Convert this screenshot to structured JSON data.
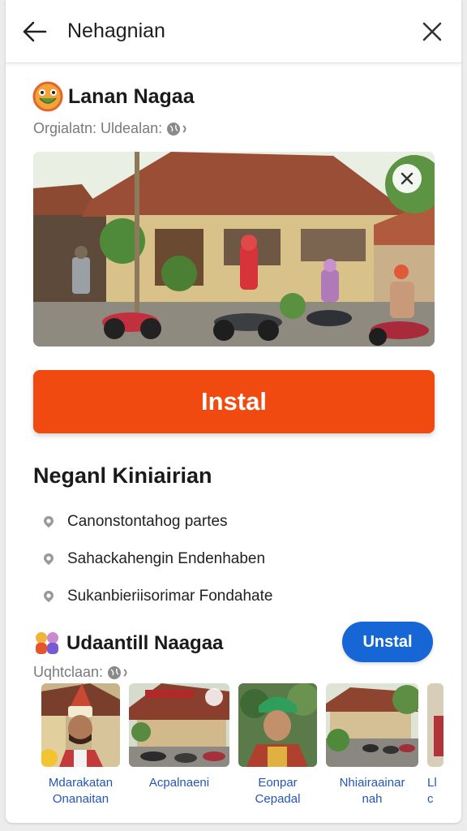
{
  "header": {
    "title": "Nehagnian",
    "back_icon": "arrow-left-icon",
    "close_icon": "close-icon"
  },
  "app": {
    "name": "Lanan Nagaa",
    "logo_icon": "smiley-logo-icon",
    "meta_text": "Orgialatn: Uldealan:",
    "meta_icon": "globe-icon"
  },
  "hero": {
    "close_icon": "close-icon"
  },
  "install_button": {
    "label": "Instal",
    "color": "#f04a10"
  },
  "features": {
    "title": "Neganl Kiniairian",
    "items": [
      "Canonstontahog partes",
      "Sahackahengin Endenhaben",
      "Sukanbieriisorimar Fondahate"
    ]
  },
  "recommended": {
    "name": "Udaantill Naagaa",
    "meta_text": "Uqhtclaan:",
    "install_label": "Unstal",
    "accent": "#1766d6",
    "items": [
      {
        "caption_line1": "Mdarakatan",
        "caption_line2": "Onanaitan"
      },
      {
        "caption_line1": "Acpalnaeni",
        "caption_line2": ""
      },
      {
        "caption_line1": "Eonpar",
        "caption_line2": "Cepadal"
      },
      {
        "caption_line1": "Nhiairaainar",
        "caption_line2": "nah"
      },
      {
        "caption_line1": "Ll",
        "caption_line2": "c"
      }
    ]
  }
}
